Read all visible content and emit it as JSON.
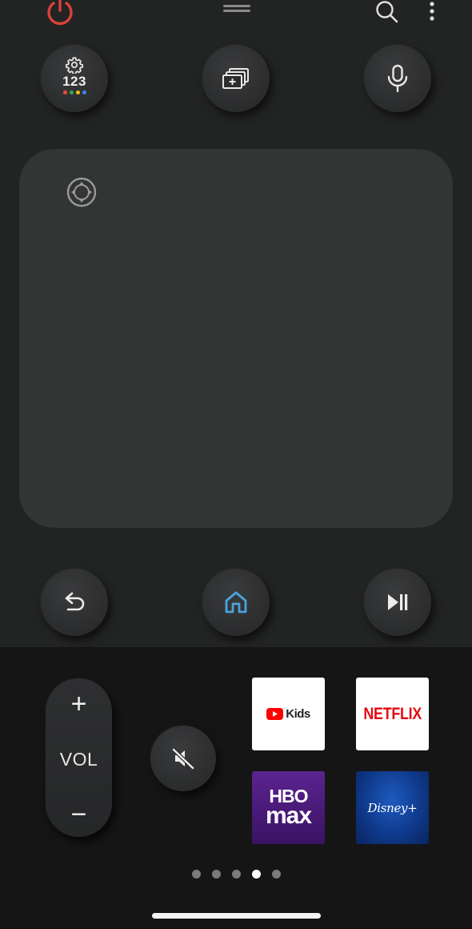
{
  "header": {
    "power_icon": "power-icon",
    "drag_handle_icon": "drag-handle-icon",
    "search_icon": "search-icon",
    "more_icon": "more-vertical-icon"
  },
  "quick_buttons": {
    "number_pad": {
      "label": "123",
      "icon": "gear-icon",
      "dot_colors": [
        "#e84b3c",
        "#34a853",
        "#f4c20d",
        "#4285f4"
      ]
    },
    "source": {
      "icon": "multi-screen-icon"
    },
    "voice": {
      "icon": "microphone-icon"
    }
  },
  "touchpad": {
    "icon": "directional-pad-icon"
  },
  "nav_buttons": {
    "back": {
      "icon": "back-arrow-icon"
    },
    "home": {
      "icon": "home-icon",
      "color": "#4aa3df"
    },
    "play_pause": {
      "icon": "play-pause-icon"
    }
  },
  "volume": {
    "plus": "+",
    "label": "VOL",
    "minus": "−"
  },
  "mute": {
    "icon": "mute-icon"
  },
  "apps": [
    {
      "name": "YouTube Kids",
      "label": "Kids"
    },
    {
      "name": "Netflix",
      "label": "NETFLIX"
    },
    {
      "name": "HBO Max",
      "label_top": "HBO",
      "label_bottom": "max"
    },
    {
      "name": "Disney+",
      "label": "Disney+"
    }
  ],
  "pager": {
    "count": 5,
    "active_index": 3
  },
  "colors": {
    "power": "#d8423a",
    "netflix": "#e50914",
    "youtube": "#ff0000",
    "hbo": "#4c1a78",
    "disney": "#0f3a8c"
  }
}
